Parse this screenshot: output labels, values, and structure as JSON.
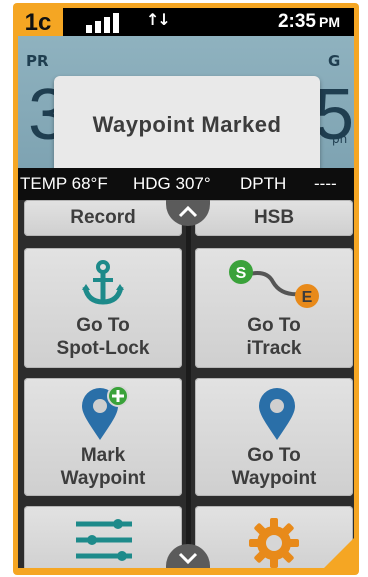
{
  "status": {
    "step": "1c",
    "time": "2:35",
    "ampm": "PM"
  },
  "gauge": {
    "left_label": "PR",
    "left_value": "3",
    "right_label": "G",
    "right_value": "5",
    "right_unit": "ph"
  },
  "popup": {
    "message": "Waypoint Marked"
  },
  "info": {
    "temp": "TEMP 68°F",
    "heading": "HDG 307°",
    "depth_label": "DPTH",
    "depth_value": "----"
  },
  "buttons": {
    "record": "Record",
    "hsb": "HSB",
    "spot_lock_line1": "Go To",
    "spot_lock_line2": "Spot-Lock",
    "itrack_line1": "Go To",
    "itrack_line2": "iTrack",
    "itrack_start": "S",
    "itrack_end": "E",
    "mark_line1": "Mark",
    "mark_line2": "Waypoint",
    "goto_wp_line1": "Go To",
    "goto_wp_line2": "Waypoint"
  },
  "colors": {
    "accent": "#f5a623",
    "icon_teal": "#1d8a8a",
    "icon_blue": "#2a6fa8",
    "icon_green": "#3aa23a",
    "icon_orange": "#e88a1a"
  }
}
